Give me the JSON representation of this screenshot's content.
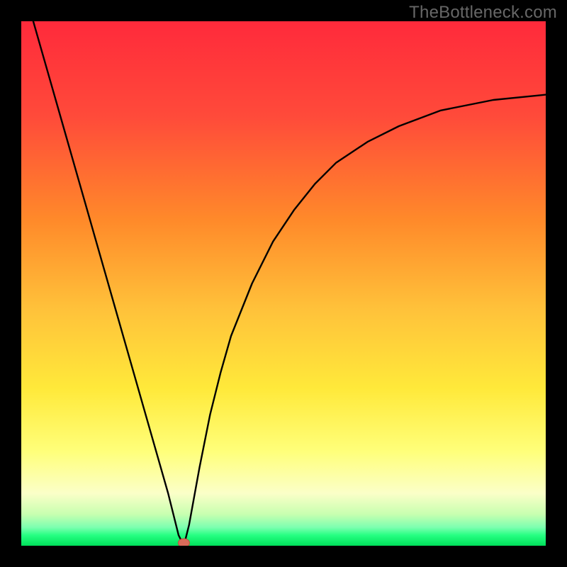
{
  "watermark": "TheBottleneck.com",
  "colors": {
    "frame": "#000000",
    "gradient_top": "#ff2a3b",
    "gradient_mid_upper": "#ff8a2a",
    "gradient_mid": "#ffd93a",
    "gradient_lower": "#ffff7a",
    "gradient_light": "#f3ffcf",
    "gradient_green": "#26ff82",
    "gradient_bottom": "#00e05a",
    "curve": "#000000",
    "marker": "#d96b5a"
  },
  "chart_data": {
    "type": "line",
    "title": "",
    "xlabel": "",
    "ylabel": "",
    "xlim": [
      0,
      100
    ],
    "ylim": [
      0,
      100
    ],
    "series": [
      {
        "name": "bottleneck-curve",
        "x": [
          0,
          2,
          4,
          6,
          8,
          10,
          12,
          14,
          16,
          18,
          20,
          22,
          24,
          26,
          28,
          30,
          31,
          32,
          34,
          36,
          38,
          40,
          44,
          48,
          52,
          56,
          60,
          66,
          72,
          80,
          90,
          100
        ],
        "values": [
          108,
          101,
          94,
          87,
          80,
          73,
          66,
          59,
          52,
          45,
          38,
          31,
          24,
          17,
          10,
          2,
          0,
          4,
          15,
          25,
          33,
          40,
          50,
          58,
          64,
          69,
          73,
          77,
          80,
          83,
          85,
          86
        ]
      }
    ],
    "annotations": [
      {
        "name": "min-marker",
        "x": 31,
        "y": 0
      }
    ],
    "legend": false,
    "grid": false
  }
}
